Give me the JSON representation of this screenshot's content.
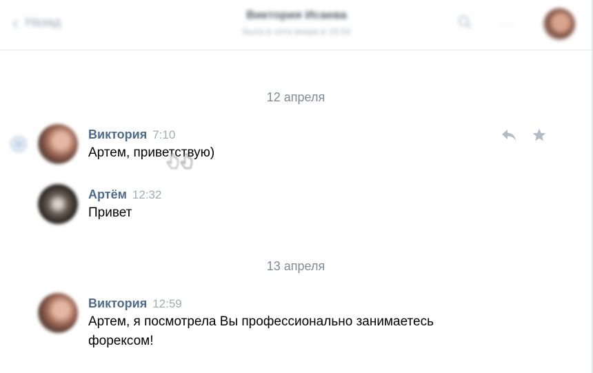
{
  "header": {
    "back_label": "Назад",
    "chat_name": "Виктория Исаева",
    "chat_status": "была в сети вчера в 19:54",
    "search_icon": "search-icon",
    "more_icon": "more-icon"
  },
  "dates": [
    "12 апреля",
    "13 апреля"
  ],
  "messages": [
    {
      "author": "Виктория",
      "time": "7:10",
      "text": "Артем, приветствую)",
      "unread": true
    },
    {
      "author": "Артём",
      "time": "12:32",
      "text": "Привет"
    },
    {
      "author": "Виктория",
      "time": "12:59",
      "text": "Артем, я посмотрела Вы профессионально занимаетесь форексом!"
    }
  ],
  "message_actions": {
    "reply_icon": "reply-icon",
    "favorite_icon": "star-icon"
  },
  "colors": {
    "author_name": "#4d6a8e",
    "time": "#a3abb5",
    "date_separator": "#828a94",
    "action_icon": "#b3bcc7",
    "divider": "#e3e6ea"
  }
}
